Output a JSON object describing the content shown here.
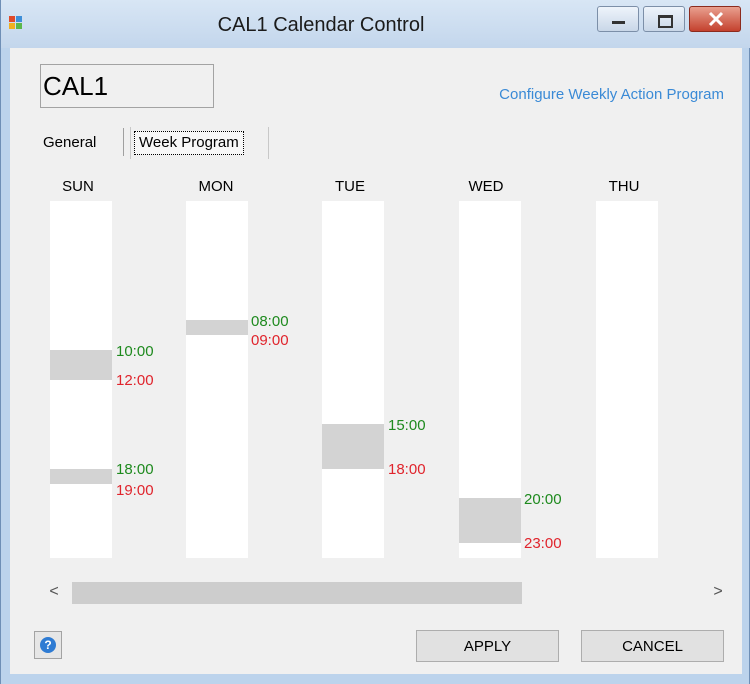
{
  "window": {
    "title": "CAL1 Calendar Control"
  },
  "header": {
    "name": "CAL1",
    "link": "Configure Weekly Action Program"
  },
  "tabs": [
    {
      "label": "General"
    },
    {
      "label": "Week Program"
    }
  ],
  "days": [
    {
      "label": "SUN",
      "on": [
        "10:00",
        "18:00"
      ],
      "off": [
        "12:00",
        "19:00"
      ]
    },
    {
      "label": "MON",
      "on": [
        "08:00"
      ],
      "off": [
        "09:00"
      ]
    },
    {
      "label": "TUE",
      "on": [
        "15:00"
      ],
      "off": [
        "18:00"
      ]
    },
    {
      "label": "WED",
      "on": [
        "20:00"
      ],
      "off": [
        "23:00"
      ]
    },
    {
      "label": "THU"
    }
  ],
  "colors": {
    "on": "#1e8a1e",
    "off": "#e0242c",
    "link": "#3a8ad6",
    "block": "#d3d3d3"
  },
  "scrollbar": {
    "left_glyph": "<",
    "right_glyph": ">"
  },
  "footer": {
    "help_glyph": "?",
    "apply": "APPLY",
    "cancel": "CANCEL"
  }
}
